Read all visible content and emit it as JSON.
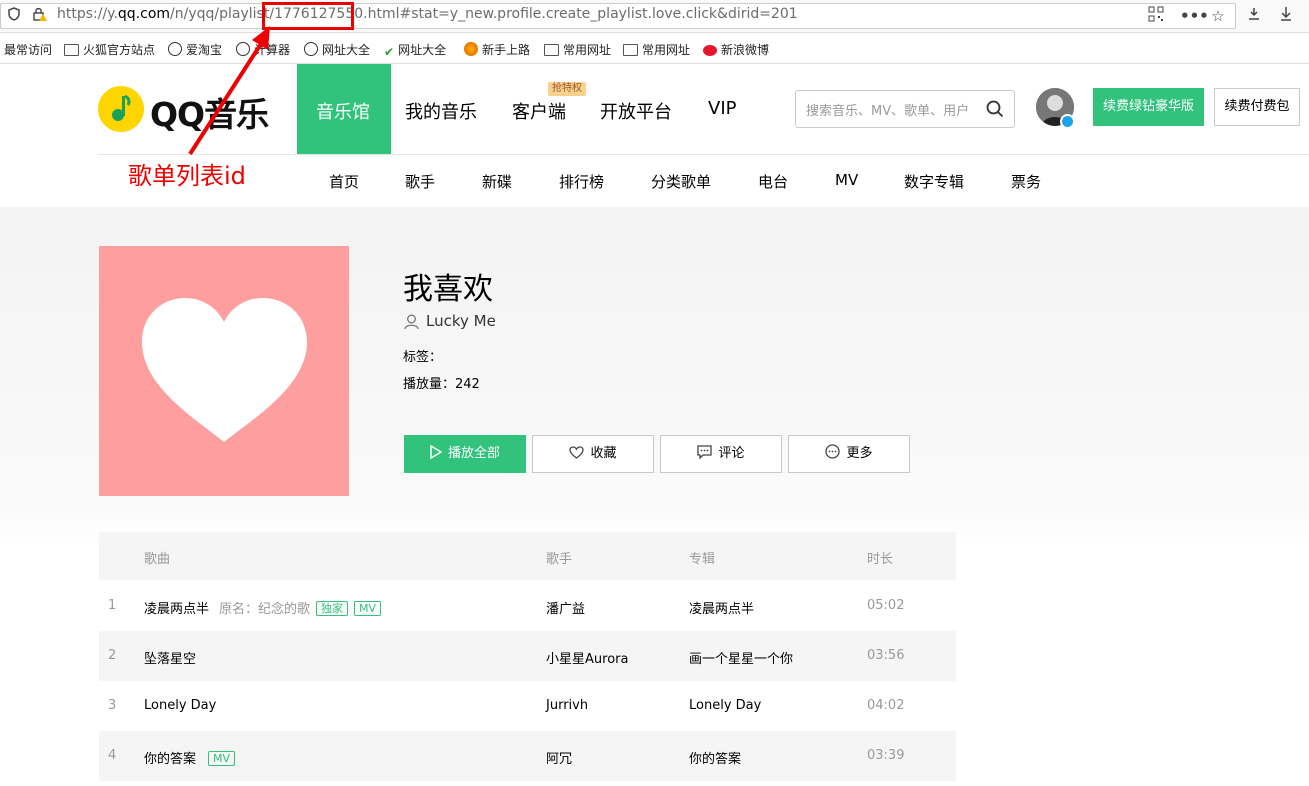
{
  "browser": {
    "url_prefix": "https://y.",
    "url_domain": "qq.com",
    "url_path": "/n/yqq/playlist/",
    "url_id": "1776127550",
    "url_suffix": ".html#stat=y_new.profile.create_playlist.love.click&dirid=201"
  },
  "bookmarks": [
    "最常访问",
    "火狐官方站点",
    "爱淘宝",
    "计算器",
    "网址大全",
    "网址大全",
    "新手上路",
    "常用网址",
    "常用网址",
    "新浪微博"
  ],
  "header": {
    "logo_text": "QQ音乐",
    "nav": [
      "音乐馆",
      "我的音乐",
      "客户端",
      "开放平台",
      "VIP"
    ],
    "nav_badge": "抢特权",
    "search_placeholder": "搜索音乐、MV、歌单、用户",
    "vip_button": "续费绿钻豪华版",
    "pay_button": "续费付费包",
    "subnav": [
      "首页",
      "歌手",
      "新碟",
      "排行榜",
      "分类歌单",
      "电台",
      "MV",
      "数字专辑",
      "票务"
    ]
  },
  "playlist": {
    "title": "我喜欢",
    "creator": "Lucky Me",
    "tags_label": "标签：",
    "plays_label": "播放量：",
    "plays_value": "242",
    "buttons": {
      "play_all": "播放全部",
      "collect": "收藏",
      "comment": "评论",
      "more": "更多"
    }
  },
  "table": {
    "headers": {
      "song": "歌曲",
      "singer": "歌手",
      "album": "专辑",
      "duration": "时长"
    },
    "rows": [
      {
        "num": "1",
        "song": "凌晨两点半",
        "sub": "原名：纪念的歌",
        "tag1": "独家",
        "tag2": "MV",
        "singer": "潘广益",
        "album": "凌晨两点半",
        "duration": "05:02"
      },
      {
        "num": "2",
        "song": "坠落星空",
        "singer": "小星星Aurora",
        "album": "画一个星星一个你",
        "duration": "03:56"
      },
      {
        "num": "3",
        "song": "Lonely Day",
        "singer": "Jurrivh",
        "album": "Lonely Day",
        "duration": "04:02"
      },
      {
        "num": "4",
        "song": "你的答案",
        "tag2": "MV",
        "singer": "阿冗",
        "album": "你的答案",
        "duration": "03:39"
      }
    ]
  },
  "annotation": {
    "label": "歌单列表id",
    "color": "#ee0000"
  },
  "colors": {
    "brand": "#31c27c",
    "logo": "#ffd500",
    "cover": "#ff9e9e"
  }
}
